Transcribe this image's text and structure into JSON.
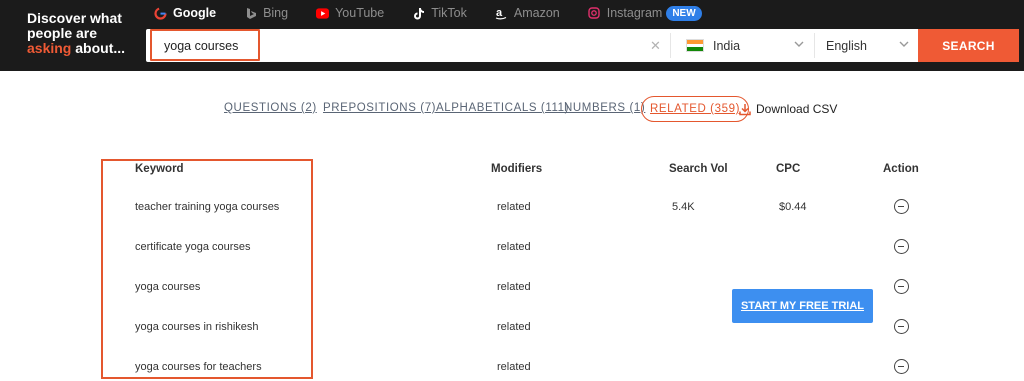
{
  "brand": {
    "line1": "Discover what",
    "line2": "people are",
    "accent": "asking",
    "line3_rest": " about..."
  },
  "engines": [
    {
      "label": "Google",
      "icon": "google-icon",
      "active": true
    },
    {
      "label": "Bing",
      "icon": "bing-icon",
      "active": false
    },
    {
      "label": "YouTube",
      "icon": "youtube-icon",
      "active": false
    },
    {
      "label": "TikTok",
      "icon": "tiktok-icon",
      "active": false
    },
    {
      "label": "Amazon",
      "icon": "amazon-icon",
      "active": false
    },
    {
      "label": "Instagram",
      "icon": "instagram-icon",
      "active": false,
      "badge": "NEW"
    }
  ],
  "search": {
    "value": "yoga courses",
    "clear_icon": "close-icon",
    "country": "India",
    "language": "English",
    "button": "SEARCH"
  },
  "tabs": [
    {
      "label": "QUESTIONS (2)",
      "active": false
    },
    {
      "label": "PREPOSITIONS (7)",
      "active": false
    },
    {
      "label": "ALPHABETICALS (111)",
      "active": false
    },
    {
      "label": "NUMBERS (1)",
      "active": false
    },
    {
      "label": "RELATED (359)",
      "active": true
    }
  ],
  "download": {
    "label": "Download CSV",
    "icon": "download-icon"
  },
  "table": {
    "headers": {
      "keyword": "Keyword",
      "modifiers": "Modifiers",
      "search_vol": "Search Vol",
      "cpc": "CPC",
      "action": "Action"
    },
    "rows": [
      {
        "keyword": "teacher training yoga courses",
        "modifier": "related",
        "search_vol": "5.4K",
        "cpc": "$0.44"
      },
      {
        "keyword": "certificate yoga courses",
        "modifier": "related",
        "search_vol": "",
        "cpc": ""
      },
      {
        "keyword": "yoga courses",
        "modifier": "related",
        "search_vol": "",
        "cpc": ""
      },
      {
        "keyword": "yoga courses in rishikesh",
        "modifier": "related",
        "search_vol": "",
        "cpc": ""
      },
      {
        "keyword": "yoga courses for teachers",
        "modifier": "related",
        "search_vol": "",
        "cpc": ""
      }
    ]
  },
  "cta": {
    "label": "START MY FREE TRIAL"
  },
  "colors": {
    "accent": "#ef5a35",
    "header_bg": "#1b1b1b",
    "cta_blue": "#3d8ff0",
    "badge_blue": "#2f7fe8"
  }
}
